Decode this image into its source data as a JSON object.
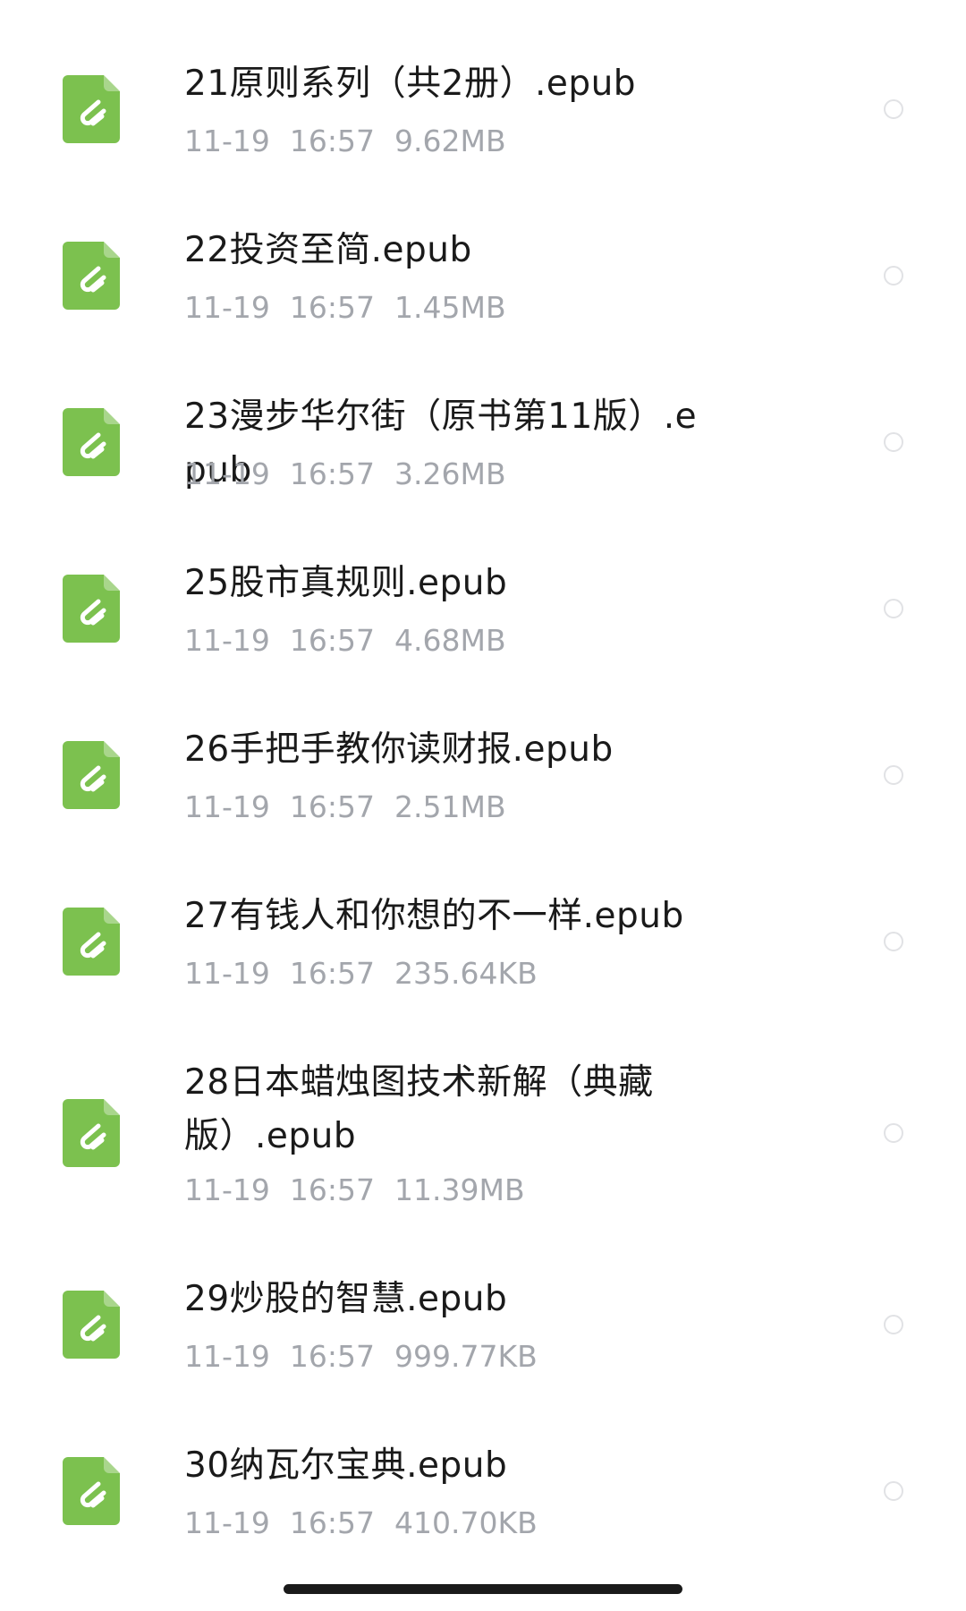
{
  "files": [
    {
      "name": "21原则系列（共2册）.epub",
      "date": "11-19",
      "time": "16:57",
      "size": "9.62MB",
      "icon": "epub-file-icon"
    },
    {
      "name": "22投资至简.epub",
      "date": "11-19",
      "time": "16:57",
      "size": "1.45MB",
      "icon": "epub-file-icon"
    },
    {
      "name": "23漫步华尔街（原书第11版）.epub",
      "date": "11-19",
      "time": "16:57",
      "size": "3.26MB",
      "icon": "epub-file-icon"
    },
    {
      "name": "25股市真规则.epub",
      "date": "11-19",
      "time": "16:57",
      "size": "4.68MB",
      "icon": "epub-file-icon"
    },
    {
      "name": "26手把手教你读财报.epub",
      "date": "11-19",
      "time": "16:57",
      "size": "2.51MB",
      "icon": "epub-file-icon"
    },
    {
      "name": "27有钱人和你想的不一样.epub",
      "date": "11-19",
      "time": "16:57",
      "size": "235.64KB",
      "icon": "epub-file-icon"
    },
    {
      "name": "28日本蜡烛图技术新解（典藏版）.epub",
      "date": "11-19",
      "time": "16:57",
      "size": "11.39MB",
      "icon": "epub-file-icon"
    },
    {
      "name": "29炒股的智慧.epub",
      "date": "11-19",
      "time": "16:57",
      "size": "999.77KB",
      "icon": "epub-file-icon"
    },
    {
      "name": "30纳瓦尔宝典.epub",
      "date": "11-19",
      "time": "16:57",
      "size": "410.70KB",
      "icon": "epub-file-icon"
    }
  ],
  "colors": {
    "icon_green": "#7cc14f",
    "meta_gray": "#a3a6ac",
    "title_text": "#1a1a1a"
  }
}
